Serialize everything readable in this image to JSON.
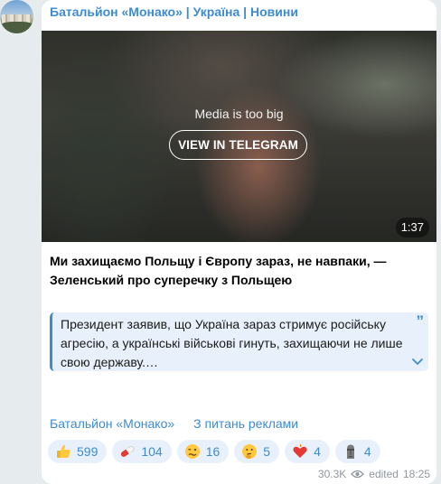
{
  "channel": {
    "title": "Батальйон «Монако» | Україна | Новини"
  },
  "media": {
    "message": "Media is too big",
    "button_label": "VIEW IN TELEGRAM",
    "duration": "1:37"
  },
  "post": {
    "title": "Ми захищаємо Польщу і Європу зараз, не навпаки, — Зеленський про суперечку з Польщею",
    "quote": "Президент заявив, що Україна зараз стримує російську агресію, а українські військові гинуть, захищаючи не лише свою державу.…"
  },
  "links": {
    "channel_link": "Батальйон «Монако»",
    "ads_link": "З питань реклами"
  },
  "reactions": [
    {
      "icon": "thumbs-up-icon",
      "count": "599"
    },
    {
      "icon": "pill-icon",
      "count": "104"
    },
    {
      "icon": "woozy-face-icon",
      "count": "16"
    },
    {
      "icon": "thinking-face-icon",
      "count": "5"
    },
    {
      "icon": "heart-on-fire-icon",
      "count": "4"
    },
    {
      "icon": "moai-icon",
      "count": "4"
    }
  ],
  "meta": {
    "views": "30.3K",
    "edited_label": "edited",
    "time": "18:25"
  },
  "colors": {
    "accent": "#3d8bd0",
    "background": "#e6ebee",
    "quote_bg": "#e8f1fb"
  }
}
